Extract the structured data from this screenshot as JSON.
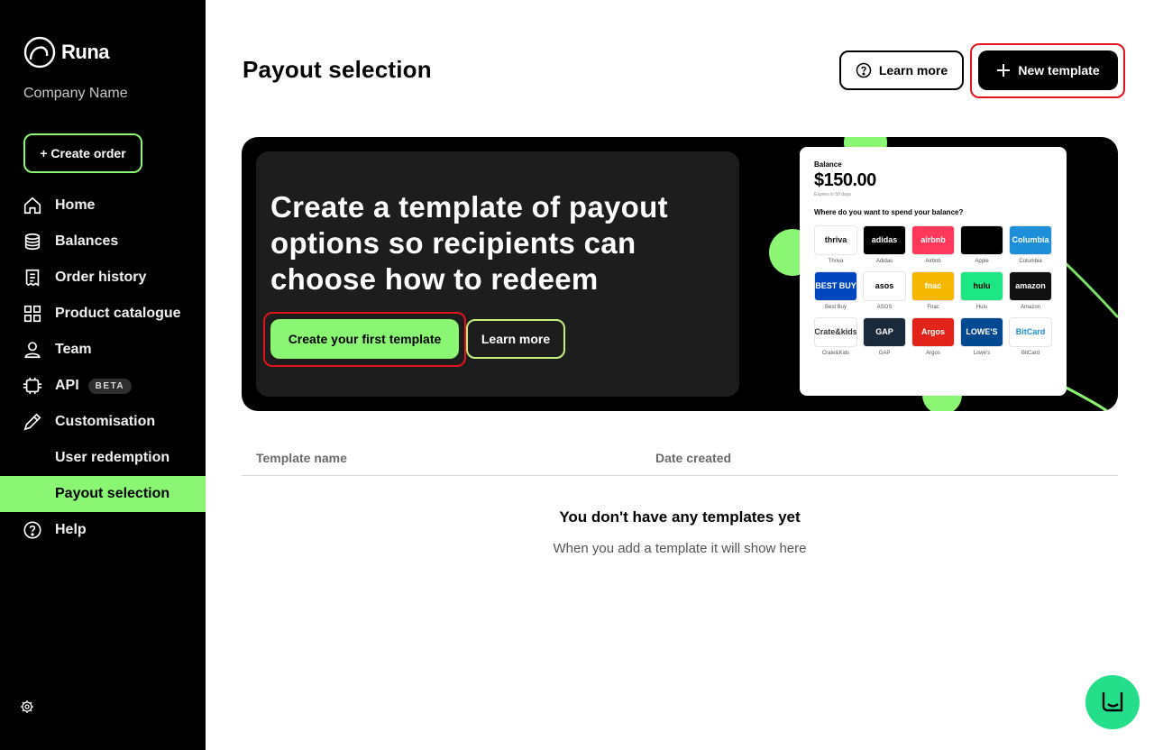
{
  "brand": {
    "logo_text": "Runa",
    "company_name": "Company Name"
  },
  "sidebar": {
    "create_order_label": "+ Create order",
    "items": [
      {
        "label": "Home",
        "icon": "home-icon"
      },
      {
        "label": "Balances",
        "icon": "coins-icon"
      },
      {
        "label": "Order history",
        "icon": "receipt-icon"
      },
      {
        "label": "Product catalogue",
        "icon": "grid-icon"
      },
      {
        "label": "Team",
        "icon": "user-icon"
      },
      {
        "label": "API",
        "icon": "api-icon",
        "badge": "BETA"
      },
      {
        "label": "Customisation",
        "icon": "pencil-icon"
      },
      {
        "label": "User redemption"
      },
      {
        "label": "Payout selection",
        "active": true
      },
      {
        "label": "Help",
        "icon": "help-icon"
      }
    ]
  },
  "header": {
    "title": "Payout selection",
    "learn_more_label": "Learn more",
    "new_template_label": "New template"
  },
  "banner": {
    "heading": "Create a template of payout options so recipients can choose how to redeem",
    "primary_label": "Create your first template",
    "secondary_label": "Learn more",
    "preview": {
      "balance_label": "Balance",
      "amount": "$150.00",
      "expires": "Expires in 59 days",
      "question": "Where do you want to spend your balance?",
      "brands": [
        {
          "name": "Thriva",
          "logo": "thriva",
          "bg": "#ffffff",
          "fg": "#111111"
        },
        {
          "name": "Adidas",
          "logo": "adidas",
          "bg": "#000000",
          "fg": "#ffffff"
        },
        {
          "name": "Airbnb",
          "logo": "airbnb",
          "bg": "#ff385c",
          "fg": "#ffffff"
        },
        {
          "name": "Apple",
          "logo": "",
          "bg": "#000000",
          "fg": "#ffffff"
        },
        {
          "name": "Columbia",
          "logo": "Columbia",
          "bg": "#1d8ed8",
          "fg": "#ffffff"
        },
        {
          "name": "Best Buy",
          "logo": "BEST BUY",
          "bg": "#0046be",
          "fg": "#ffffff"
        },
        {
          "name": "ASOS",
          "logo": "asos",
          "bg": "#ffffff",
          "fg": "#000000"
        },
        {
          "name": "Fnac",
          "logo": "fnac",
          "bg": "#f5b700",
          "fg": "#ffffff"
        },
        {
          "name": "Hulu",
          "logo": "hulu",
          "bg": "#1ce783",
          "fg": "#000000"
        },
        {
          "name": "Amazon",
          "logo": "amazon",
          "bg": "#111111",
          "fg": "#ffffff"
        },
        {
          "name": "Crate&Kids",
          "logo": "Crate&kids",
          "bg": "#ffffff",
          "fg": "#333333"
        },
        {
          "name": "GAP",
          "logo": "GAP",
          "bg": "#1b2a3a",
          "fg": "#ffffff"
        },
        {
          "name": "Argos",
          "logo": "Argos",
          "bg": "#e2231a",
          "fg": "#ffffff"
        },
        {
          "name": "Lowe's",
          "logo": "LOWE'S",
          "bg": "#004990",
          "fg": "#ffffff"
        },
        {
          "name": "BitCard",
          "logo": "BitCard",
          "bg": "#ffffff",
          "fg": "#1d8ed8"
        }
      ]
    }
  },
  "table": {
    "columns": [
      "Template name",
      "Date created"
    ],
    "empty_title": "You don't have any templates yet",
    "empty_subtitle": "When you add a template it will show here"
  },
  "colors": {
    "accent": "#8bf574",
    "highlight": "#e1141b",
    "chat": "#24de8a"
  }
}
